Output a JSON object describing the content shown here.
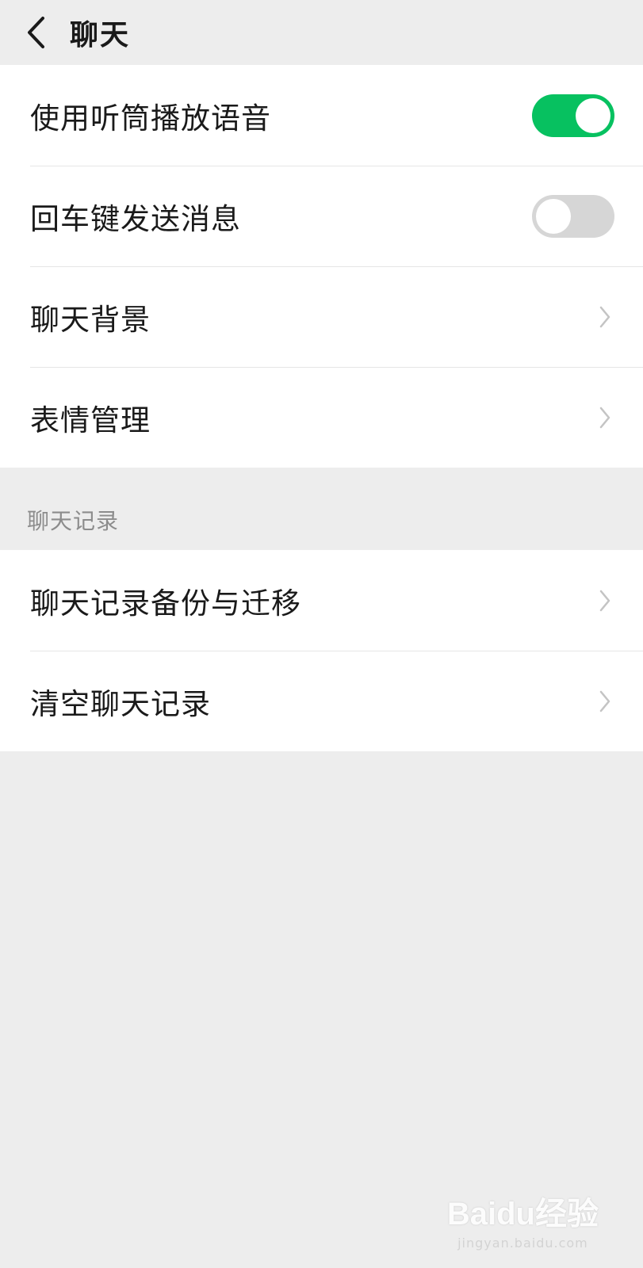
{
  "header": {
    "title": "聊天",
    "back_icon": "chevron-left-icon"
  },
  "settings": {
    "items": [
      {
        "label": "使用听筒播放语音",
        "control": "toggle",
        "state": "on"
      },
      {
        "label": "回车键发送消息",
        "control": "toggle",
        "state": "off"
      },
      {
        "label": "聊天背景",
        "control": "chevron"
      },
      {
        "label": "表情管理",
        "control": "chevron"
      }
    ]
  },
  "chat_history": {
    "section_title": "聊天记录",
    "items": [
      {
        "label": "聊天记录备份与迁移",
        "control": "chevron"
      },
      {
        "label": "清空聊天记录",
        "control": "chevron"
      }
    ]
  },
  "watermark": {
    "brand": "Baidu经验",
    "domain": "jingyan.baidu.com"
  },
  "colors": {
    "accent_green": "#07c160",
    "toggle_off": "#d6d6d6",
    "page_background": "#ededed",
    "row_background": "#ffffff"
  }
}
